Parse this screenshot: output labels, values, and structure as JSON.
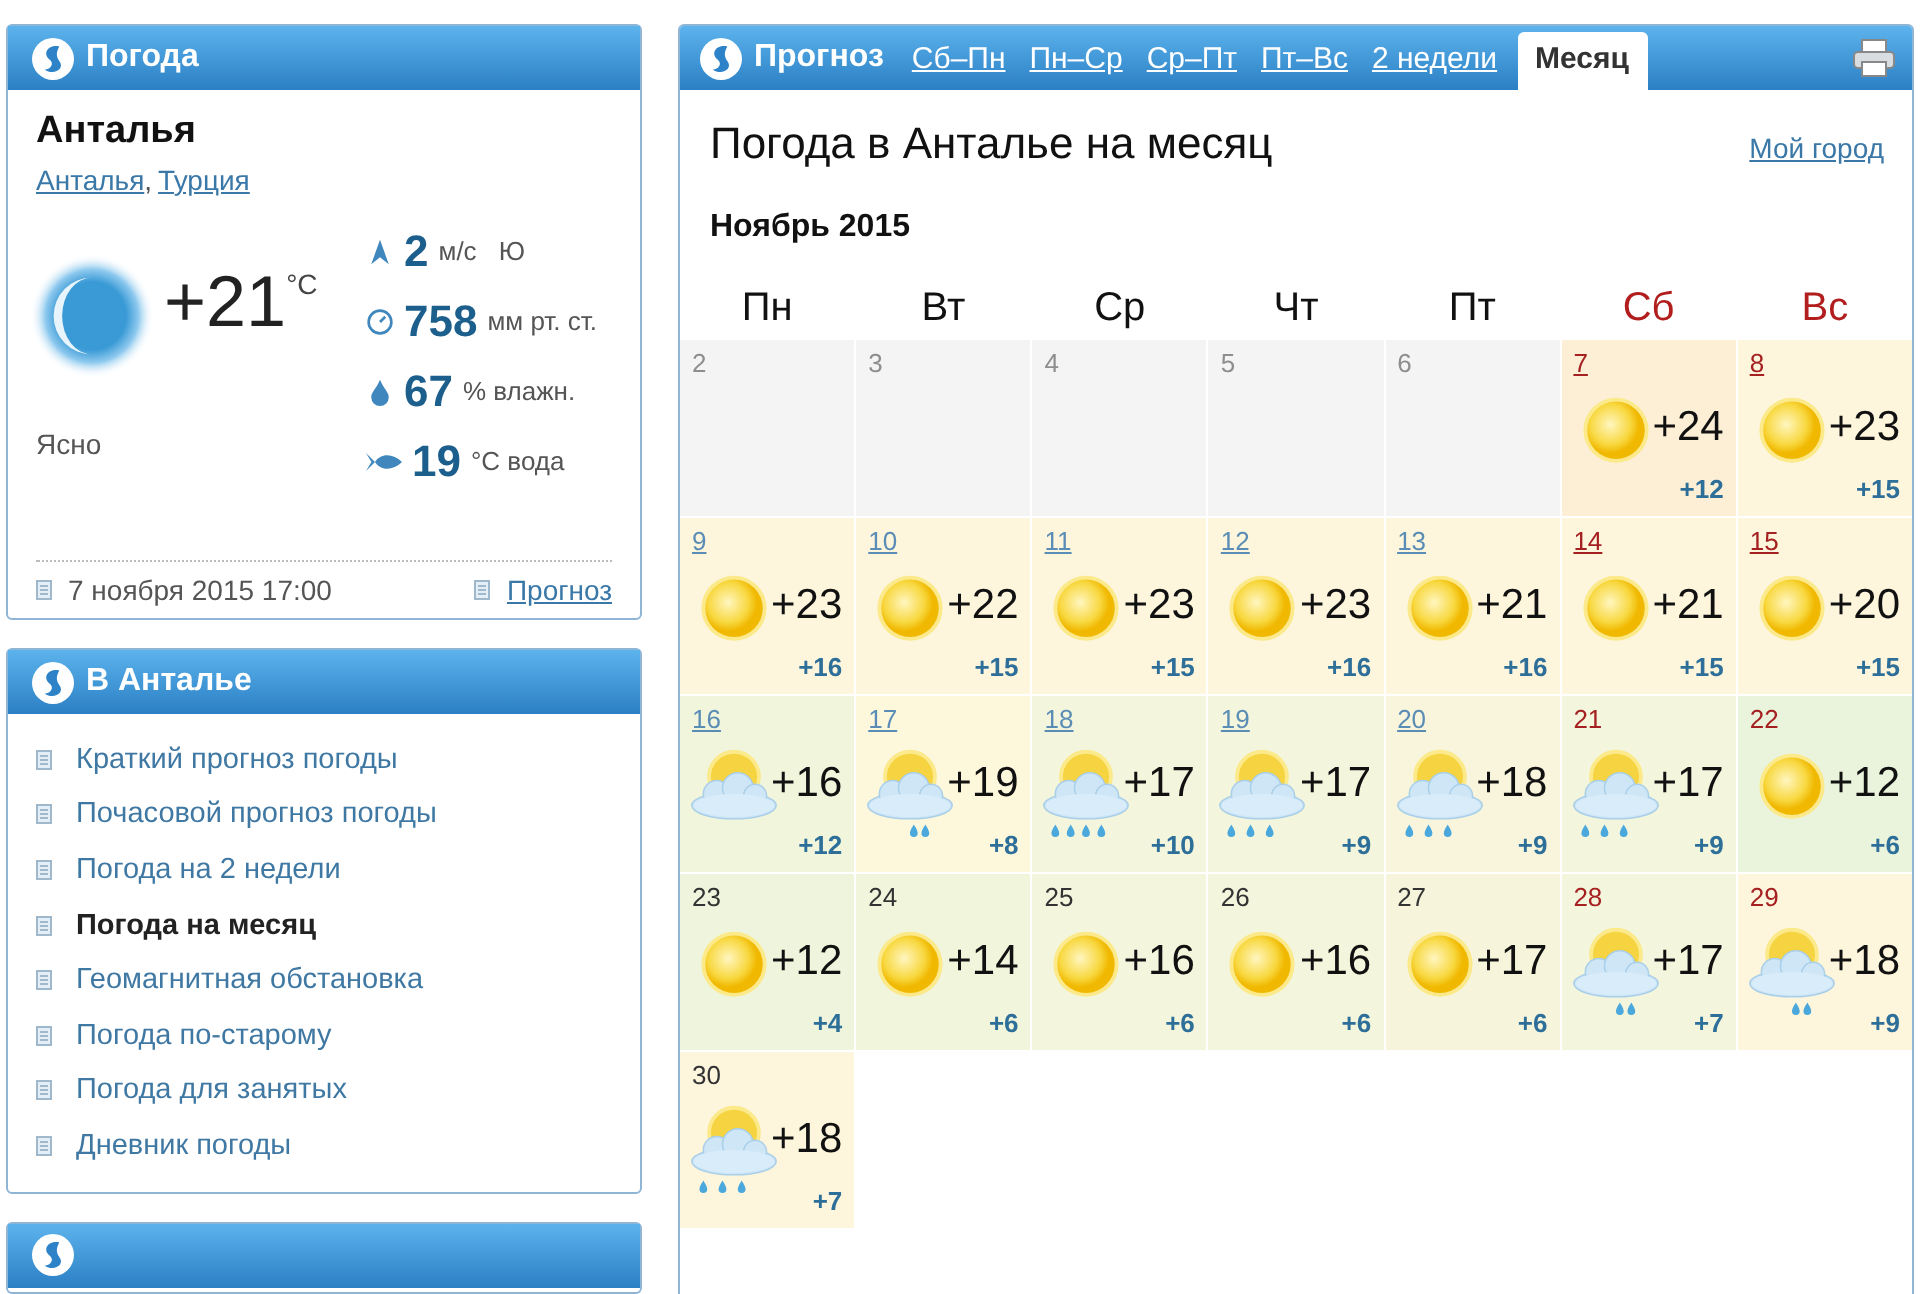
{
  "current": {
    "header": "Погода",
    "city": "Анталья",
    "location_links": [
      "Анталья",
      "Турция"
    ],
    "location_separator": ",",
    "temperature": "+21",
    "temperature_unit": "°C",
    "condition": "Ясно",
    "stats": [
      {
        "kind": "wind",
        "value": "2",
        "unit": "м/с",
        "extra": "Ю"
      },
      {
        "kind": "pressure",
        "value": "758",
        "unit": "мм рт. ст."
      },
      {
        "kind": "humidity",
        "value": "67",
        "unit": "% влажн."
      },
      {
        "kind": "water",
        "value": "19",
        "unit": "°C вода"
      }
    ],
    "updated": "7 ноября 2015 17:00",
    "forecast_link": "Прогноз"
  },
  "city_menu": {
    "header": "В Анталье",
    "items": [
      {
        "label": "Краткий прогноз погоды",
        "selected": false
      },
      {
        "label": "Почасовой прогноз погоды",
        "selected": false
      },
      {
        "label": "Погода на 2 недели",
        "selected": false
      },
      {
        "label": "Погода на месяц",
        "selected": true
      },
      {
        "label": "Геомагнитная обстановка",
        "selected": false
      },
      {
        "label": "Погода по-старому",
        "selected": false
      },
      {
        "label": "Погода для занятых",
        "selected": false
      },
      {
        "label": "Дневник погоды",
        "selected": false
      }
    ]
  },
  "forecast": {
    "header": "Прогноз",
    "tabs": [
      {
        "label": "Сб–Пн",
        "selected": false
      },
      {
        "label": "Пн–Ср",
        "selected": false
      },
      {
        "label": "Ср–Пт",
        "selected": false
      },
      {
        "label": "Пт–Вс",
        "selected": false
      },
      {
        "label": "2 недели",
        "selected": false
      },
      {
        "label": "Месяц",
        "selected": true
      }
    ],
    "title": "Погода в Анталье на месяц",
    "my_city_link": "Мой город",
    "month": "Ноябрь 2015",
    "weekdays": [
      {
        "label": "Пн",
        "weekend": false
      },
      {
        "label": "Вт",
        "weekend": false
      },
      {
        "label": "Ср",
        "weekend": false
      },
      {
        "label": "Чт",
        "weekend": false
      },
      {
        "label": "Пт",
        "weekend": false
      },
      {
        "label": "Сб",
        "weekend": true
      },
      {
        "label": "Вс",
        "weekend": true
      }
    ],
    "weeks": [
      [
        {
          "day": "2",
          "kind": "past",
          "link": false,
          "color": "#f4f4f4"
        },
        {
          "day": "3",
          "kind": "past",
          "link": false,
          "color": "#f4f4f4"
        },
        {
          "day": "4",
          "kind": "past",
          "link": false,
          "color": "#f4f4f4"
        },
        {
          "day": "5",
          "kind": "past",
          "link": false,
          "color": "#f4f4f4"
        },
        {
          "day": "6",
          "kind": "past",
          "link": false,
          "color": "#f4f4f4"
        },
        {
          "day": "7",
          "kind": "sunny",
          "link": true,
          "color": "#fdefd6",
          "temp": "+24",
          "night": "+12"
        },
        {
          "day": "8",
          "kind": "sunny",
          "link": true,
          "color": "#fdf5dc",
          "temp": "+23",
          "night": "+15"
        }
      ],
      [
        {
          "day": "9",
          "kind": "sunny",
          "link": true,
          "color": "#fdf5dc",
          "temp": "+23",
          "night": "+16"
        },
        {
          "day": "10",
          "kind": "sunny",
          "link": true,
          "color": "#fdf5dc",
          "temp": "+22",
          "night": "+15"
        },
        {
          "day": "11",
          "kind": "sunny",
          "link": true,
          "color": "#fdf5dc",
          "temp": "+23",
          "night": "+15"
        },
        {
          "day": "12",
          "kind": "sunny",
          "link": true,
          "color": "#fdf5dc",
          "temp": "+23",
          "night": "+16"
        },
        {
          "day": "13",
          "kind": "sunny",
          "link": true,
          "color": "#fdf5dc",
          "temp": "+21",
          "night": "+16"
        },
        {
          "day": "14",
          "kind": "sunny",
          "link": true,
          "color": "#fdf5dc",
          "temp": "+21",
          "night": "+15"
        },
        {
          "day": "15",
          "kind": "sunny",
          "link": true,
          "color": "#fdf5dc",
          "temp": "+20",
          "night": "+15"
        }
      ],
      [
        {
          "day": "16",
          "kind": "cloudy",
          "link": true,
          "color": "#f1f5dc",
          "temp": "+16",
          "night": "+12"
        },
        {
          "day": "17",
          "kind": "drizzle",
          "link": true,
          "color": "#fdf7dc",
          "temp": "+19",
          "night": "+8"
        },
        {
          "day": "18",
          "kind": "showers",
          "link": true,
          "color": "#f3f5dc",
          "temp": "+17",
          "night": "+10"
        },
        {
          "day": "19",
          "kind": "rain",
          "link": true,
          "color": "#f3f5dc",
          "temp": "+17",
          "night": "+9"
        },
        {
          "day": "20",
          "kind": "rain",
          "link": true,
          "color": "#f8f5dc",
          "temp": "+18",
          "night": "+9"
        },
        {
          "day": "21",
          "kind": "rain",
          "link": false,
          "color": "#f3f5dc",
          "temp": "+17",
          "night": "+9"
        },
        {
          "day": "22",
          "kind": "sunny",
          "link": false,
          "color": "#eaf3dc",
          "temp": "+12",
          "night": "+6"
        }
      ],
      [
        {
          "day": "23",
          "kind": "sunny",
          "link": false,
          "color": "#eef5dc",
          "temp": "+12",
          "night": "+4"
        },
        {
          "day": "24",
          "kind": "sunny",
          "link": false,
          "color": "#f0f5dc",
          "temp": "+14",
          "night": "+6"
        },
        {
          "day": "25",
          "kind": "sunny",
          "link": false,
          "color": "#f3f5dc",
          "temp": "+16",
          "night": "+6"
        },
        {
          "day": "26",
          "kind": "sunny",
          "link": false,
          "color": "#f3f5dc",
          "temp": "+16",
          "night": "+6"
        },
        {
          "day": "27",
          "kind": "sunny",
          "link": false,
          "color": "#f6f5dc",
          "temp": "+17",
          "night": "+6"
        },
        {
          "day": "28",
          "kind": "drizzle",
          "link": false,
          "color": "#f3f5dc",
          "temp": "+17",
          "night": "+7"
        },
        {
          "day": "29",
          "kind": "drizzle",
          "link": false,
          "color": "#fdf5dc",
          "temp": "+18",
          "night": "+9"
        }
      ],
      [
        {
          "day": "30",
          "kind": "rain",
          "link": false,
          "color": "#fdf5dc",
          "temp": "+18",
          "night": "+7"
        }
      ]
    ]
  }
}
